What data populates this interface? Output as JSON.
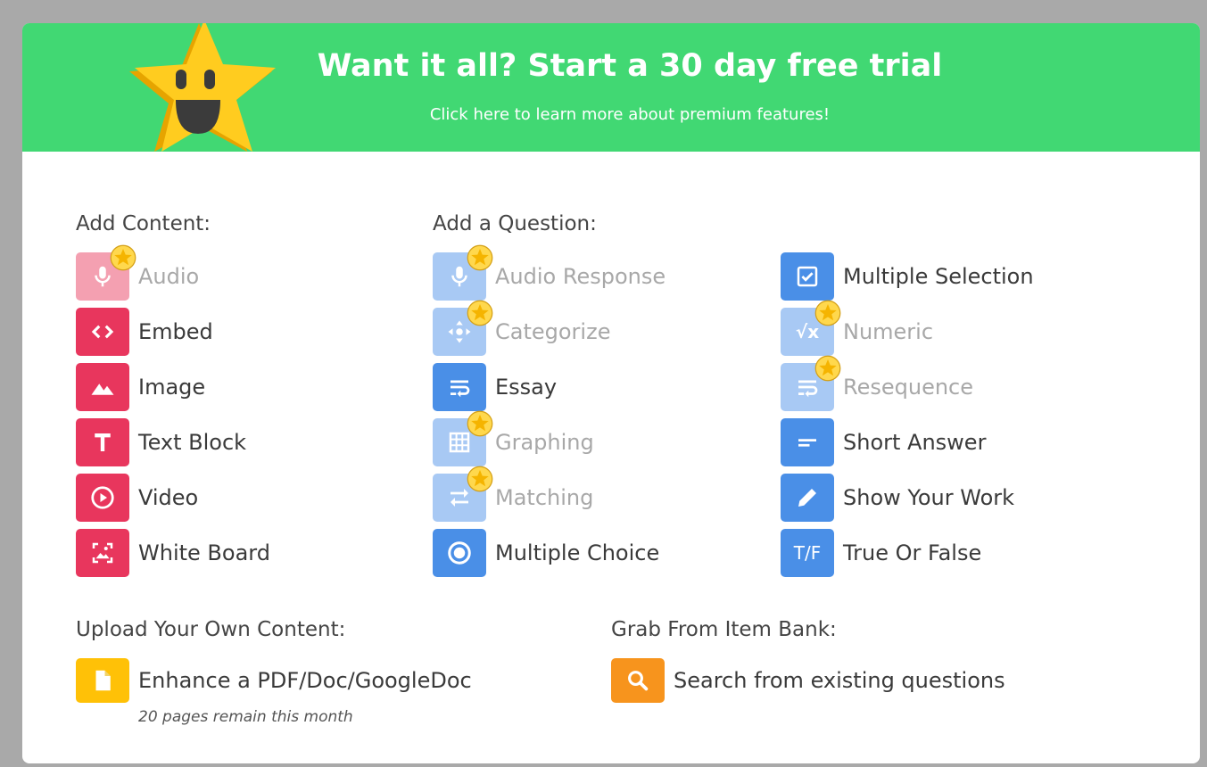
{
  "banner": {
    "title": "Want it all? Start a 30 day free trial",
    "subtitle": "Click here to learn more about premium features!"
  },
  "add_content": {
    "heading": "Add Content:",
    "items": [
      {
        "label": "Audio",
        "icon": "microphone-icon",
        "premium": true
      },
      {
        "label": "Embed",
        "icon": "code-icon",
        "premium": false
      },
      {
        "label": "Image",
        "icon": "mountain-image-icon",
        "premium": false
      },
      {
        "label": "Text Block",
        "icon": "text-t-icon",
        "premium": false
      },
      {
        "label": "Video",
        "icon": "play-circle-icon",
        "premium": false
      },
      {
        "label": "White Board",
        "icon": "whiteboard-icon",
        "premium": false
      }
    ]
  },
  "add_question": {
    "heading": "Add a Question:",
    "items": [
      {
        "label": "Audio Response",
        "icon": "microphone-icon",
        "premium": true
      },
      {
        "label": "Categorize",
        "icon": "move-arrows-icon",
        "premium": true
      },
      {
        "label": "Essay",
        "icon": "wrap-text-icon",
        "premium": false
      },
      {
        "label": "Graphing",
        "icon": "grid-icon",
        "premium": true
      },
      {
        "label": "Matching",
        "icon": "swap-arrows-icon",
        "premium": true
      },
      {
        "label": "Multiple Choice",
        "icon": "radio-icon",
        "premium": false
      },
      {
        "label": "Multiple Selection",
        "icon": "checkbox-icon",
        "premium": false
      },
      {
        "label": "Numeric",
        "icon": "square-root-icon",
        "premium": true,
        "icon_text": "√x"
      },
      {
        "label": "Resequence",
        "icon": "wrap-text-icon",
        "premium": true
      },
      {
        "label": "Short Answer",
        "icon": "short-lines-icon",
        "premium": false
      },
      {
        "label": "Show Your Work",
        "icon": "pencil-icon",
        "premium": false
      },
      {
        "label": "True Or False",
        "icon": "true-false-icon",
        "premium": false,
        "icon_text": "T/F"
      }
    ]
  },
  "upload": {
    "heading": "Upload Your Own Content:",
    "item_label": "Enhance a PDF/Doc/GoogleDoc",
    "icon": "document-icon",
    "note": "20 pages remain this month"
  },
  "item_bank": {
    "heading": "Grab From Item Bank:",
    "item_label": "Search from existing questions",
    "icon": "search-icon"
  },
  "colors": {
    "banner": "#41d873",
    "content_red": "#e8365d",
    "question_blue": "#4a8fe7",
    "upload_yellow": "#ffc107",
    "bank_orange": "#f7941d"
  }
}
